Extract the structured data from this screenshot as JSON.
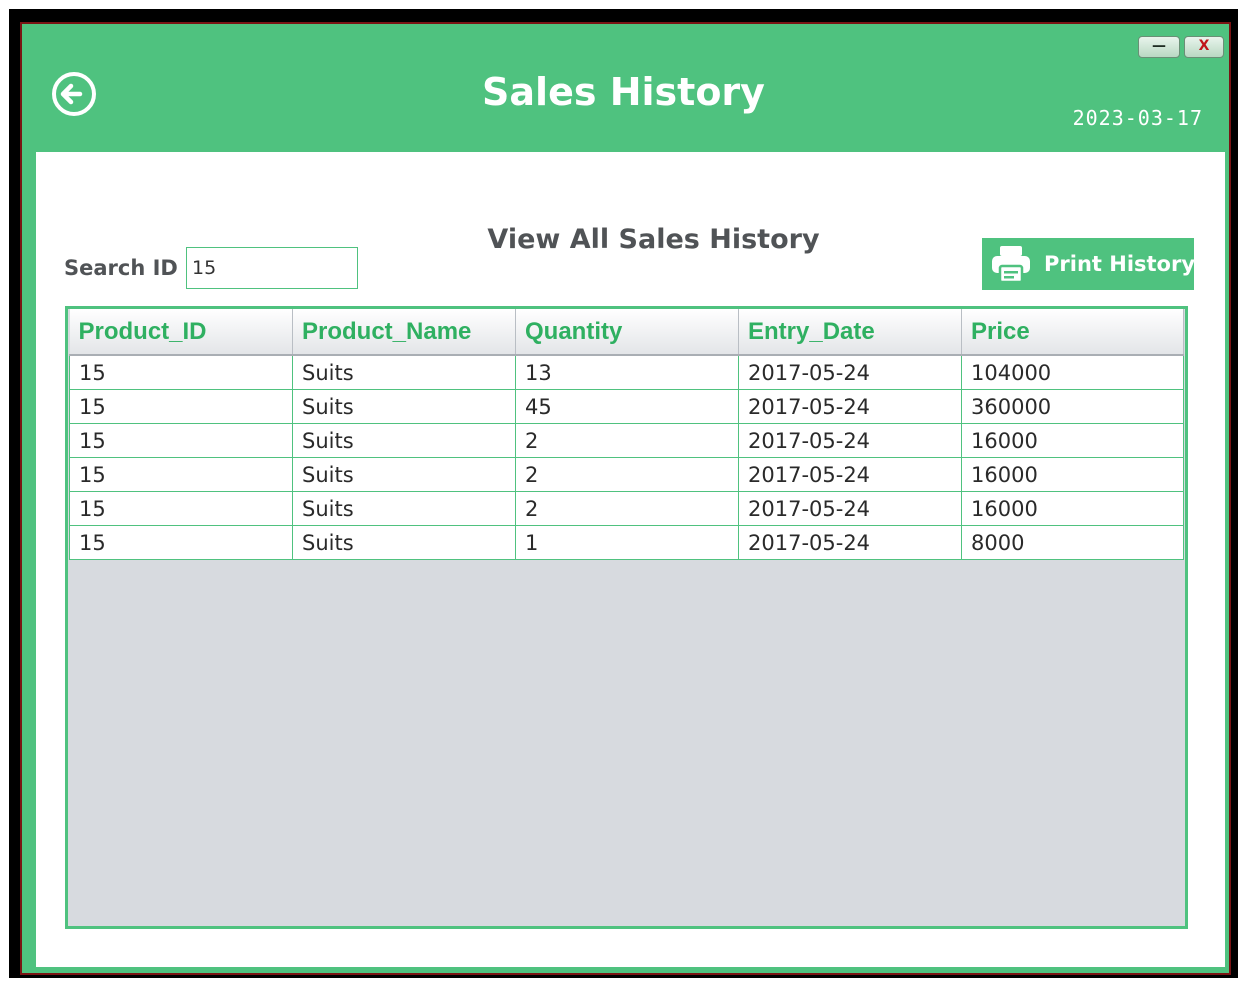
{
  "window": {
    "title": "Sales History",
    "date": "2023-03-17",
    "minimize_label": "—",
    "close_label": "X"
  },
  "icons": {
    "back": "back-arrow-circle-icon",
    "print": "printer-icon"
  },
  "colors": {
    "accent": "#4fc27f",
    "header_text": "#2fb061",
    "empty_area": "#d7dadf"
  },
  "main": {
    "subtitle": "View All Sales History",
    "search": {
      "label": "Search ID",
      "value": "15"
    },
    "print_button_label": "Print History"
  },
  "table": {
    "columns": [
      "Product_ID",
      "Product_Name",
      "Quantity",
      "Entry_Date",
      "Price"
    ],
    "rows": [
      [
        "15",
        "Suits",
        "13",
        "2017-05-24",
        "104000"
      ],
      [
        "15",
        "Suits",
        "45",
        "2017-05-24",
        "360000"
      ],
      [
        "15",
        "Suits",
        "2",
        "2017-05-24",
        "16000"
      ],
      [
        "15",
        "Suits",
        "2",
        "2017-05-24",
        "16000"
      ],
      [
        "15",
        "Suits",
        "2",
        "2017-05-24",
        "16000"
      ],
      [
        "15",
        "Suits",
        "1",
        "2017-05-24",
        "8000"
      ]
    ]
  }
}
